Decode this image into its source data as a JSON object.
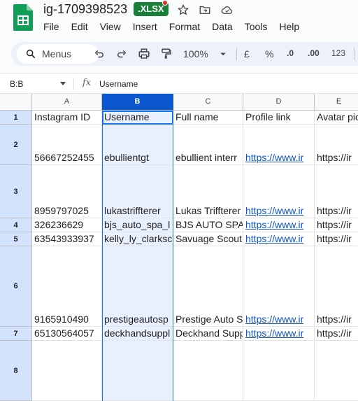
{
  "app": {
    "doc_title": "ig-1709398523",
    "file_badge": ".XLSX",
    "brand_color": "#0f9d58",
    "badge_color": "#188038"
  },
  "menu": [
    "File",
    "Edit",
    "View",
    "Insert",
    "Format",
    "Data",
    "Tools",
    "Help"
  ],
  "toolbar": {
    "search_label": "Menus",
    "zoom": "100%",
    "currency": "£",
    "percent": "%",
    "decrease_decimal": ".0",
    "increase_decimal": ".00",
    "number_format": "123"
  },
  "formula_bar": {
    "name_box": "B:B",
    "fx": "fx",
    "value": "Username"
  },
  "columns": [
    "A",
    "B",
    "C",
    "D",
    "E"
  ],
  "selected_column": "B",
  "rows": [
    {
      "num": "1",
      "cells": [
        "Instagram ID",
        "Username",
        "Full name",
        "Profile link",
        "Avatar pic"
      ]
    },
    {
      "num": "2",
      "cells": [
        "56667252455",
        "ebullientgt",
        "ebullient interr",
        "https://www.ir",
        "https://ir"
      ]
    },
    {
      "num": "3",
      "cells": [
        "8959797025",
        "lukastriffterer",
        "Lukas Triffterer",
        "https://www.ir",
        "https://ir"
      ]
    },
    {
      "num": "4",
      "cells": [
        "326236629",
        "bjs_auto_spa_l",
        "BJS AUTO SPA L",
        "https://www.ir",
        "https://ir"
      ]
    },
    {
      "num": "5",
      "cells": [
        "63543933937",
        "kelly_ly_clarksc",
        "Savuage Scout",
        "https://www.ir",
        "https://ir"
      ]
    },
    {
      "num": "6",
      "cells": [
        "9165910490",
        "prestigeautosp",
        "Prestige Auto S",
        "https://www.ir",
        "https://ir"
      ]
    },
    {
      "num": "7",
      "cells": [
        "65130564057",
        "deckhandsuppl",
        "Deckhand Supp",
        "https://www.ir",
        "https://ir"
      ]
    },
    {
      "num": "8",
      "cells": [
        "",
        "",
        "",
        "",
        ""
      ]
    }
  ]
}
